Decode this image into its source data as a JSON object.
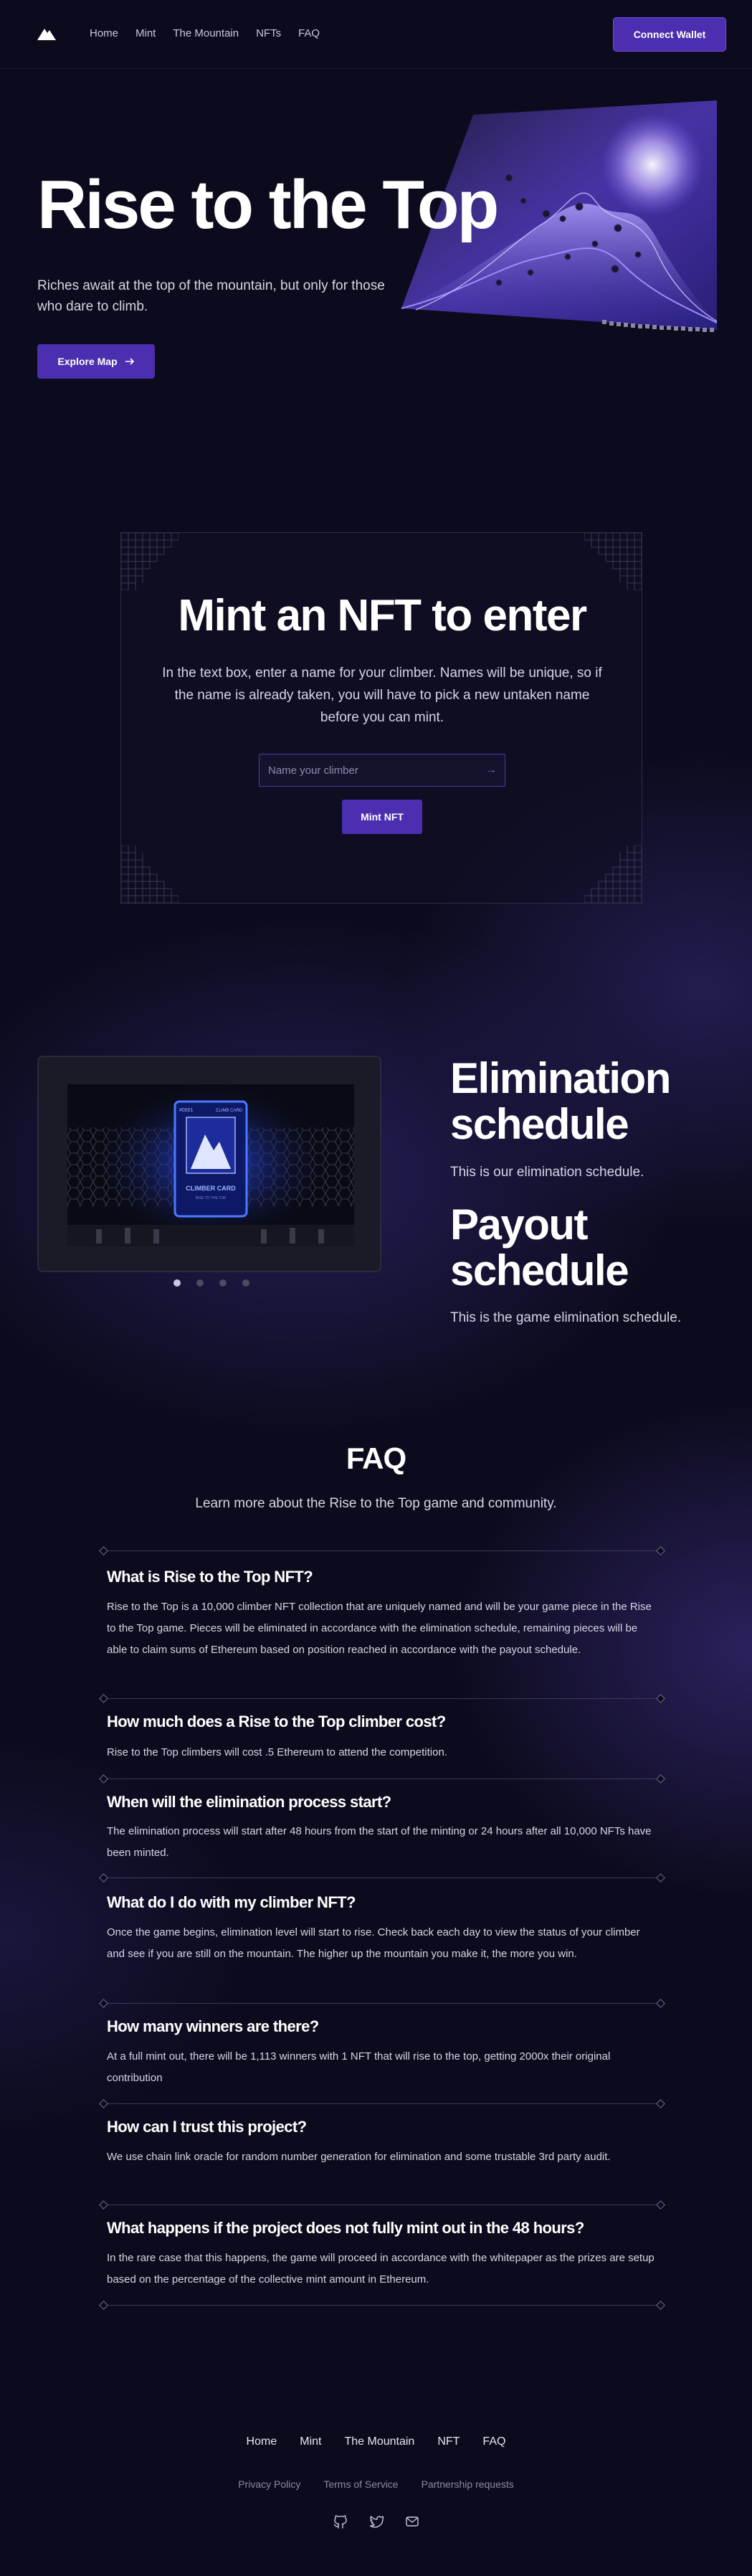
{
  "nav": {
    "logo": "mountain-logo-icon",
    "links": [
      "Home",
      "Mint",
      "The Mountain",
      "NFTs",
      "FAQ"
    ],
    "connect_label": "Connect Wallet"
  },
  "hero": {
    "title": "Rise to the Top",
    "subtitle": "Riches await at the top of the mountain, but only for those who dare to climb.",
    "cta_label": "Explore Map",
    "cta_icon": "arrow-right-icon"
  },
  "mint": {
    "title": "Mint an NFT to enter",
    "description": "In the text box, enter a name for your climber. Names will be unique, so if the name is already taken, you will have to pick a new untaken name before you can mint.",
    "input_placeholder": "Name your climber",
    "button_label": "Mint NFT"
  },
  "schedule": {
    "card": {
      "top_left": "#0001",
      "top_right": "CLIMB CARD",
      "name": "CLIMBER CARD",
      "sub": "RISE TO THE TOP"
    },
    "slides_count": 4,
    "active_slide": 1,
    "elimination_title": "Elimination schedule",
    "elimination_desc": "This is our elimination schedule.",
    "payout_title": "Payout schedule",
    "payout_desc": "This is the game elimination schedule."
  },
  "faq": {
    "title": "FAQ",
    "subtitle": "Learn more about the Rise to the Top game and community.",
    "items": [
      {
        "q": "What is Rise to the Top NFT?",
        "a": "Rise to the Top is a 10,000 climber NFT collection that are uniquely named and will be your game piece in the Rise to the Top game. Pieces will be eliminated in accordance with the elimination schedule, remaining pieces will be able to claim sums of Ethereum based on position reached in accordance with the payout schedule."
      },
      {
        "q": "How much does a Rise to the Top climber cost?",
        "a": "Rise to the Top climbers will cost .5 Ethereum to attend the competition."
      },
      {
        "q": "When will the elimination process start?",
        "a": "The elimination process will start after 48 hours from the start of the minting or 24 hours after all 10,000 NFTs have been minted."
      },
      {
        "q": "What do I do with my climber NFT?",
        "a": "Once the game begins, elimination level will start to rise. Check back each day to view the status of your climber and see if you are still on the mountain. The higher up the mountain you make it, the more you win."
      },
      {
        "q": "How many winners are there?",
        "a": "At a full mint out, there will be 1,113 winners with 1 NFT that will rise to the top, getting 2000x their original contribution"
      },
      {
        "q": "How can I trust this project?",
        "a": "We use chain link oracle for random number generation for elimination and some trustable 3rd party audit."
      },
      {
        "q": "What happens if the project does not fully mint out in the 48 hours?",
        "a": "In the rare case that this happens, the game will proceed in accordance with the whitepaper as the prizes are setup based on the percentage of the collective mint amount in Ethereum."
      }
    ]
  },
  "footer": {
    "links": [
      "Home",
      "Mint",
      "The Mountain",
      "NFT",
      "FAQ"
    ],
    "legal": [
      "Privacy Policy",
      "Terms of Service",
      "Partnership requests"
    ],
    "socials": [
      "github-icon",
      "twitter-icon",
      "mail-icon"
    ]
  },
  "colors": {
    "background": "#0c0b1d",
    "accent": "#4b2fb0",
    "text_muted": "#d6d5e6"
  }
}
